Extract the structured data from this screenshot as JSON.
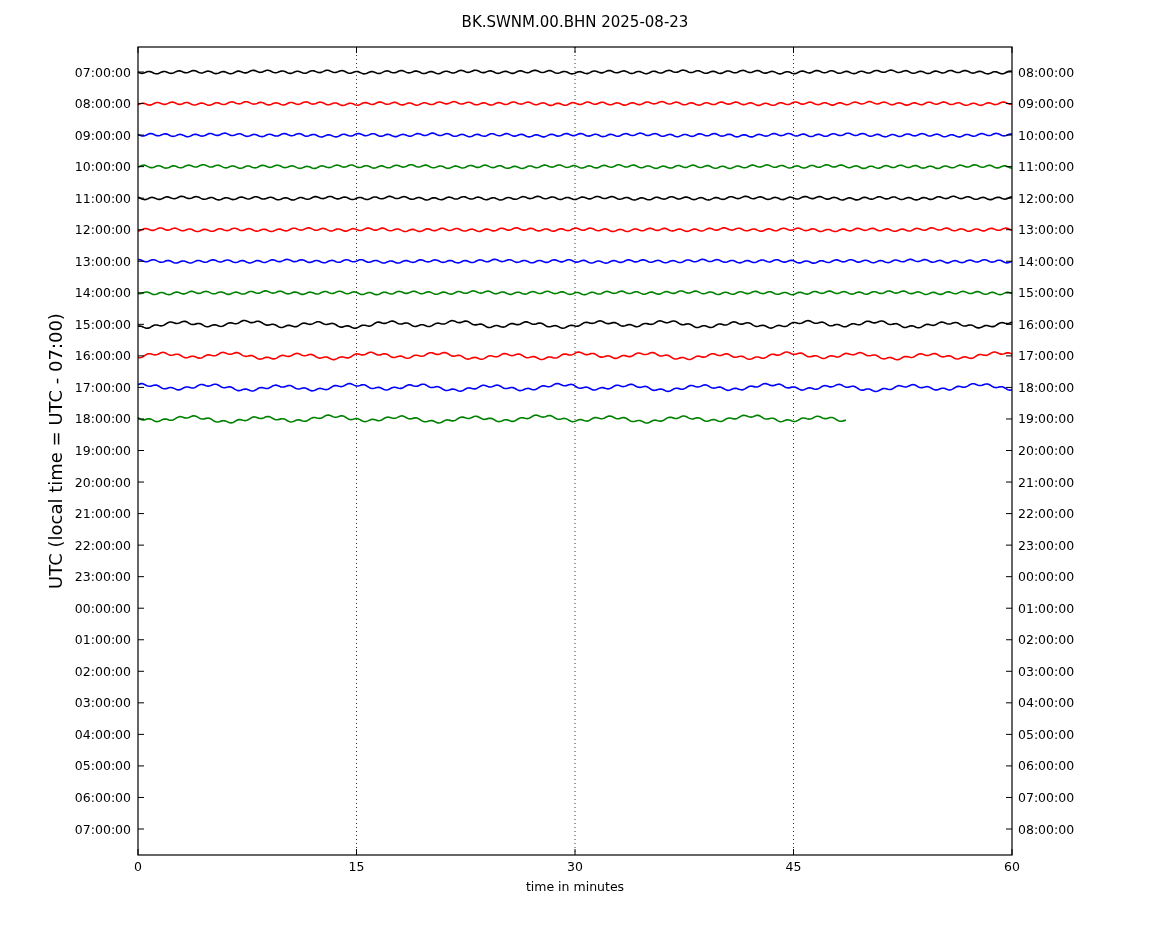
{
  "chart": {
    "title": "BK.SWNM.00.BHN 2025-08-23",
    "ylabel": "UTC (local time = UTC - 07:00)",
    "xlabel": "time in minutes",
    "xticks": [
      "0",
      "15",
      "30",
      "45",
      "60"
    ],
    "left_labels": [
      "07:00:00",
      "08:00:00",
      "09:00:00",
      "10:00:00",
      "11:00:00",
      "12:00:00",
      "13:00:00",
      "14:00:00",
      "15:00:00",
      "16:00:00",
      "17:00:00",
      "18:00:00",
      "19:00:00",
      "20:00:00",
      "21:00:00",
      "22:00:00",
      "23:00:00",
      "00:00:00",
      "01:00:00",
      "02:00:00",
      "03:00:00",
      "04:00:00",
      "05:00:00",
      "06:00:00",
      "07:00:00"
    ],
    "right_labels": [
      "08:00:00",
      "09:00:00",
      "10:00:00",
      "11:00:00",
      "12:00:00",
      "13:00:00",
      "14:00:00",
      "15:00:00",
      "16:00:00",
      "17:00:00",
      "18:00:00",
      "19:00:00",
      "20:00:00",
      "21:00:00",
      "22:00:00",
      "23:00:00",
      "00:00:00",
      "01:00:00",
      "02:00:00",
      "03:00:00",
      "04:00:00",
      "05:00:00",
      "06:00:00",
      "07:00:00",
      "08:00:00"
    ],
    "traces": [
      {
        "color": "#000000",
        "level": 1
      },
      {
        "color": "#ff0000",
        "level": 1
      },
      {
        "color": "#0000ff",
        "level": 1
      },
      {
        "color": "#008000",
        "level": 1
      },
      {
        "color": "#000000",
        "level": 1
      },
      {
        "color": "#ff0000",
        "level": 1
      },
      {
        "color": "#0000ff",
        "level": 1
      },
      {
        "color": "#008000",
        "level": 1
      },
      {
        "color": "#000000",
        "level": 1
      },
      {
        "color": "#ff0000",
        "level": 1
      },
      {
        "color": "#0000ff",
        "level": 1
      },
      {
        "color": "#008000",
        "level": 0.81
      }
    ]
  }
}
